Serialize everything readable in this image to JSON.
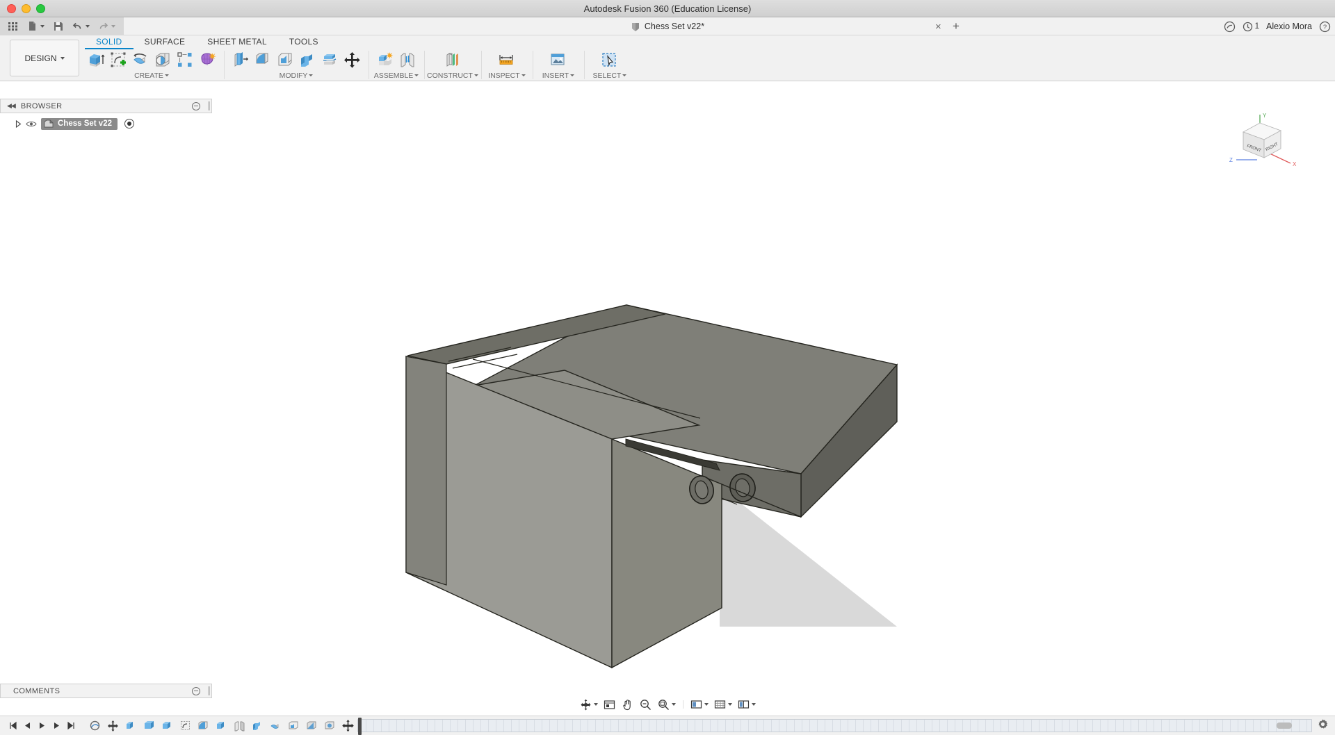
{
  "window": {
    "title": "Autodesk Fusion 360 (Education License)",
    "traffic_lights": [
      "close",
      "minimize",
      "zoom"
    ]
  },
  "quick_access": {
    "grid_label": "grid-menu",
    "file_label": "file-menu",
    "save_label": "save",
    "undo_label": "undo",
    "redo_label": "redo",
    "document_tab": "Chess Set v22*",
    "close_tab": "×",
    "new_tab": "+",
    "notification_count": "1",
    "user_name": "Alexio Mora",
    "help_label": "?"
  },
  "ribbon": {
    "design_workspace": "DESIGN",
    "tabs": [
      {
        "label": "SOLID",
        "active": true
      },
      {
        "label": "SURFACE",
        "active": false
      },
      {
        "label": "SHEET METAL",
        "active": false
      },
      {
        "label": "TOOLS",
        "active": false
      }
    ],
    "panels": [
      {
        "label": "CREATE",
        "has_caret": true,
        "tools": [
          "extrude-icon",
          "create-sketch-icon",
          "revolve-icon",
          "sweep-icon",
          "pattern-icon",
          "create-form-icon"
        ]
      },
      {
        "label": "MODIFY",
        "has_caret": true,
        "tools": [
          "press-pull-icon",
          "fillet-icon",
          "shell-icon",
          "combine-icon",
          "split-face-icon",
          "move-copy-icon"
        ]
      },
      {
        "label": "ASSEMBLE",
        "has_caret": true,
        "tools": [
          "new-component-icon",
          "joint-icon"
        ]
      },
      {
        "label": "CONSTRUCT",
        "has_caret": true,
        "tools": [
          "offset-plane-icon"
        ]
      },
      {
        "label": "INSPECT",
        "has_caret": true,
        "tools": [
          "measure-icon"
        ]
      },
      {
        "label": "INSERT",
        "has_caret": true,
        "tools": [
          "insert-image-icon"
        ]
      },
      {
        "label": "SELECT",
        "has_caret": true,
        "tools": [
          "select-cursor-icon"
        ]
      }
    ]
  },
  "browser": {
    "header": "BROWSER",
    "collapse_icon": "◀◀",
    "root": {
      "name": "Chess Set v22",
      "selected": true,
      "expand_icon": "triangle-right-icon",
      "visibility_icon": "eye-icon",
      "component_icon": "component-icon",
      "activate_icon": "radio-dot-icon"
    }
  },
  "comments": {
    "header": "COMMENTS"
  },
  "viewcube": {
    "face_front": "FRONT",
    "face_right": "RIGHT",
    "axis_x": "X",
    "axis_y": "Y",
    "axis_z": "Z",
    "axis_x_color": "#e05a5a",
    "axis_y_color": "#57a957",
    "axis_z_color": "#5a7fe0"
  },
  "navigation_bar": {
    "buttons": [
      {
        "name": "orbit-icon",
        "caret": true
      },
      {
        "name": "look-at-icon",
        "caret": false
      },
      {
        "name": "pan-icon",
        "caret": false
      },
      {
        "name": "zoom-icon",
        "caret": false
      },
      {
        "name": "zoom-fit-icon",
        "caret": true
      },
      {
        "name": "display-settings-icon",
        "caret": true
      },
      {
        "name": "grid-snap-icon",
        "caret": true
      },
      {
        "name": "viewports-icon",
        "caret": true
      }
    ]
  },
  "timeline": {
    "playback": [
      "skip-start-icon",
      "step-back-icon",
      "play-icon",
      "step-forward-icon",
      "skip-end-icon"
    ],
    "features": [
      "sketch-icon",
      "move-icon",
      "extrude-icon",
      "extrude2-icon",
      "extrude3-icon",
      "sketch2-icon",
      "fillet-icon",
      "extrude4-icon",
      "mirror-icon",
      "combine-icon",
      "revolve-icon",
      "shell-icon",
      "chamfer-icon",
      "hole-icon",
      "move2-icon"
    ],
    "settings_icon": "gear-icon"
  },
  "model": {
    "description": "3D isometric view of a grey machined bracket / hinge block with two counterbored holes on the right face and a rectangular slot step on top",
    "body_fill": "#8d8d87",
    "top_fill": "#7d7d76",
    "front_fill": "#979791",
    "shadow_fill": "#d9d9d9",
    "edge_color": "#2b2b28"
  }
}
